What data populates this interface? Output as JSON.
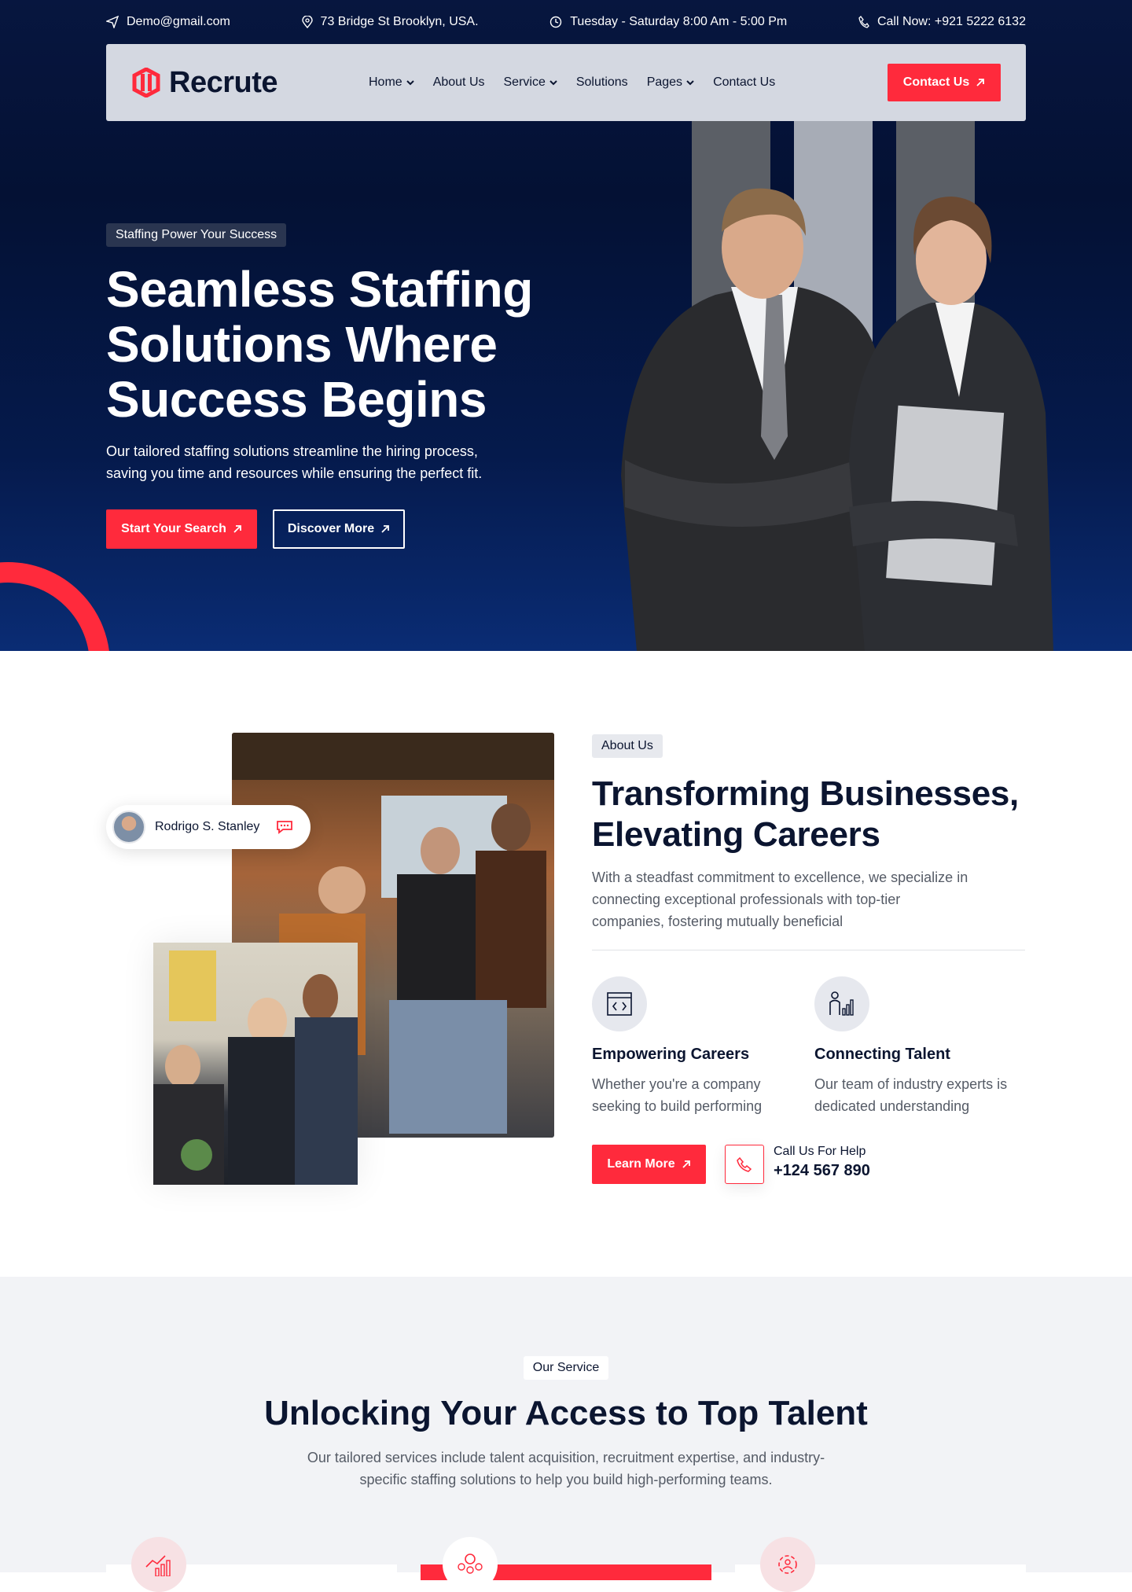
{
  "topbar": {
    "email": "Demo@gmail.com",
    "address": "73 Bridge St Brooklyn, USA.",
    "hours": "Tuesday - Saturday 8:00 Am - 5:00 Pm",
    "phone": "Call Now: +921 5222 6132"
  },
  "nav": {
    "logo_text": "Recrute",
    "items": [
      {
        "label": "Home",
        "dropdown": true
      },
      {
        "label": "About Us",
        "dropdown": false
      },
      {
        "label": "Service",
        "dropdown": true
      },
      {
        "label": "Solutions",
        "dropdown": false
      },
      {
        "label": "Pages",
        "dropdown": true
      },
      {
        "label": "Contact Us",
        "dropdown": false
      }
    ],
    "cta": "Contact Us"
  },
  "hero": {
    "tag": "Staffing Power Your Success",
    "title_l1": "Seamless Staffing",
    "title_l2": "Solutions Where",
    "title_l3": "Success Begins",
    "desc_l1": "Our tailored staffing solutions streamline the hiring process,",
    "desc_l2": "saving you time and resources while ensuring the perfect fit.",
    "btn_primary": "Start Your Search",
    "btn_secondary": "Discover More"
  },
  "about": {
    "badge_name": "Rodrigo S. Stanley",
    "tag": "About Us",
    "title_l1": "Transforming Businesses,",
    "title_l2": "Elevating Careers",
    "desc_l1": "With a steadfast commitment to excellence, we specialize in",
    "desc_l2": "connecting exceptional professionals with top-tier",
    "desc_l3": "companies, fostering mutually beneficial",
    "features": [
      {
        "title": "Empowering Careers",
        "l1": "Whether you're a company",
        "l2": "seeking to build performing",
        "icon": "browser-code-icon"
      },
      {
        "title": "Connecting Talent",
        "l1": "Our team of industry experts is",
        "l2": "dedicated understanding",
        "icon": "person-chart-icon"
      }
    ],
    "btn": "Learn More",
    "call_label": "Call Us For Help",
    "call_number": "+124 567 890"
  },
  "services": {
    "tag": "Our Service",
    "title": "Unlocking Your Access to Top Talent",
    "desc_l1": "Our tailored services include talent acquisition, recruitment expertise, and industry-",
    "desc_l2": "specific staffing solutions to help you build high-performing teams."
  },
  "colors": {
    "accent": "#ff2a3c",
    "navy": "#0b1530",
    "hero_bg": "#041134"
  }
}
